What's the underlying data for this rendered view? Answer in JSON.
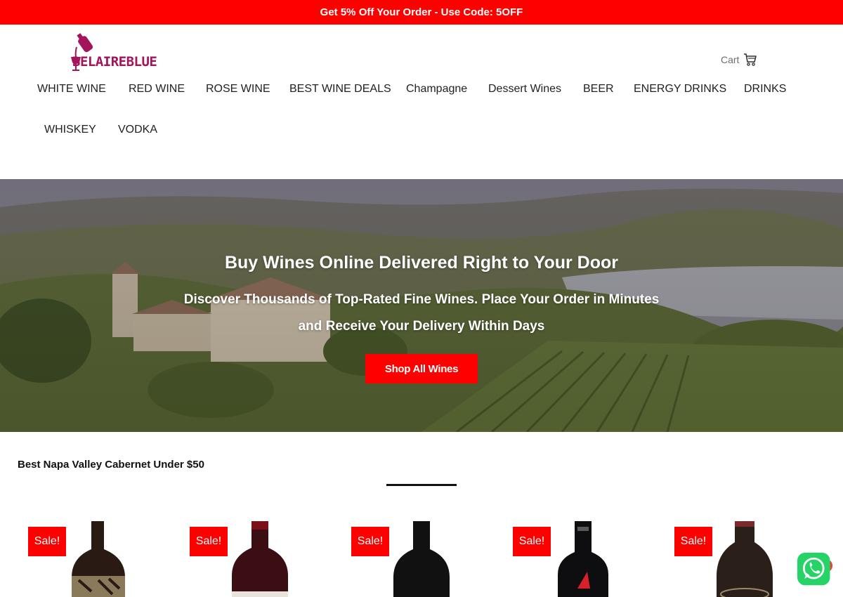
{
  "promo": {
    "text": "Get 5% Off Your Order - Use Code: 5OFF"
  },
  "logo": {
    "text": "BELAIREBLUE",
    "icon": "wine-pour-icon"
  },
  "cart": {
    "label": "Cart",
    "icon": "cart-icon"
  },
  "nav": {
    "items": [
      "WHITE WINE",
      "RED WINE",
      "ROSE WINE",
      "BEST WINE DEALS",
      "Champagne",
      "Dessert Wines",
      "BEER",
      "ENERGY DRINKS",
      "DRINKS",
      "WHISKEY",
      "VODKA"
    ]
  },
  "hero": {
    "title": "Buy Wines Online Delivered Right to Your Door",
    "subtitle": "Discover Thousands of Top-Rated Fine Wines. Place Your Order in Minutes and Receive Your Delivery Within Days",
    "button": "Shop All Wines"
  },
  "section": {
    "title": "Best Napa Valley Cabernet Under $50"
  },
  "products": [
    {
      "badge": "Sale!"
    },
    {
      "badge": "Sale!"
    },
    {
      "badge": "Sale!"
    },
    {
      "badge": "Sale!"
    },
    {
      "badge": "Sale!"
    }
  ],
  "whatsapp": {
    "icon": "whatsapp-icon"
  },
  "colors": {
    "accent": "#ff0000",
    "brand": "#a3145c",
    "text": "#222222"
  }
}
